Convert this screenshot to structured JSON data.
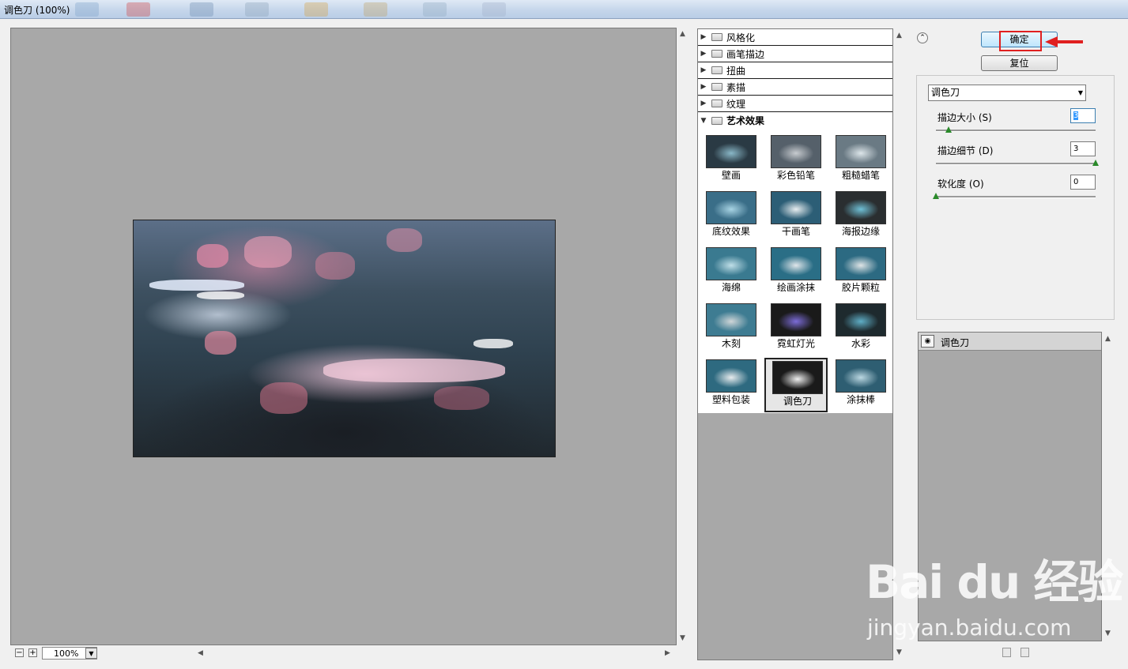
{
  "window": {
    "title": "调色刀 (100%)"
  },
  "preview": {
    "zoom": "100%",
    "zoom_out": "−",
    "zoom_in": "+"
  },
  "gallery": {
    "categories": [
      {
        "label": "风格化",
        "expanded": false
      },
      {
        "label": "画笔描边",
        "expanded": false
      },
      {
        "label": "扭曲",
        "expanded": false
      },
      {
        "label": "素描",
        "expanded": false
      },
      {
        "label": "纹理",
        "expanded": false
      },
      {
        "label": "艺术效果",
        "expanded": true
      }
    ],
    "filters": [
      {
        "label": "壁画",
        "colors": [
          "#2a3a44",
          "#8ab8c8"
        ]
      },
      {
        "label": "彩色铅笔",
        "colors": [
          "#55606a",
          "#c8ccd0"
        ]
      },
      {
        "label": "粗糙蜡笔",
        "colors": [
          "#6a7a84",
          "#dde6ea"
        ]
      },
      {
        "label": "底纹效果",
        "colors": [
          "#3a6e88",
          "#a8d4e4"
        ]
      },
      {
        "label": "干画笔",
        "colors": [
          "#2c5e76",
          "#e8eef0"
        ]
      },
      {
        "label": "海报边缘",
        "colors": [
          "#2a2e30",
          "#6fc0d6"
        ]
      },
      {
        "label": "海绵",
        "colors": [
          "#3a7a90",
          "#c0dfe8"
        ]
      },
      {
        "label": "绘画涂抹",
        "colors": [
          "#2a6e86",
          "#e0e6ea"
        ]
      },
      {
        "label": "胶片颗粒",
        "colors": [
          "#2c6a82",
          "#dfe4e6"
        ]
      },
      {
        "label": "木刻",
        "colors": [
          "#3e7c92",
          "#d0d6d8"
        ]
      },
      {
        "label": "霓虹灯光",
        "colors": [
          "#1a1a1a",
          "#7c6cd8"
        ]
      },
      {
        "label": "水彩",
        "colors": [
          "#1e2a2e",
          "#5faec6"
        ]
      },
      {
        "label": "塑料包装",
        "colors": [
          "#2e6a80",
          "#e8ecee"
        ]
      },
      {
        "label": "调色刀",
        "colors": [
          "#1a1a1a",
          "#f0f0f0"
        ],
        "selected": true
      },
      {
        "label": "涂抹棒",
        "colors": [
          "#2e5e72",
          "#bcd8e2"
        ]
      }
    ]
  },
  "actions": {
    "ok": "确定",
    "reset": "复位",
    "collapse_icon": "chevron-double-up-icon"
  },
  "settings": {
    "filter_name": "调色刀",
    "params": [
      {
        "label": "描边大小 (S)",
        "value": "3",
        "level": 0.08
      },
      {
        "label": "描边细节 (D)",
        "value": "3",
        "level": 1.0
      },
      {
        "label": "软化度 (O)",
        "value": "0",
        "level": 0.0
      }
    ]
  },
  "layers": {
    "items": [
      {
        "label": "调色刀",
        "visible": true
      }
    ]
  },
  "watermark": {
    "main": "Bai du 经验",
    "sub": "jingyan.baidu.com"
  },
  "colors": {
    "highlight": "#e02020",
    "panel_bg": "#a8a8a8"
  }
}
